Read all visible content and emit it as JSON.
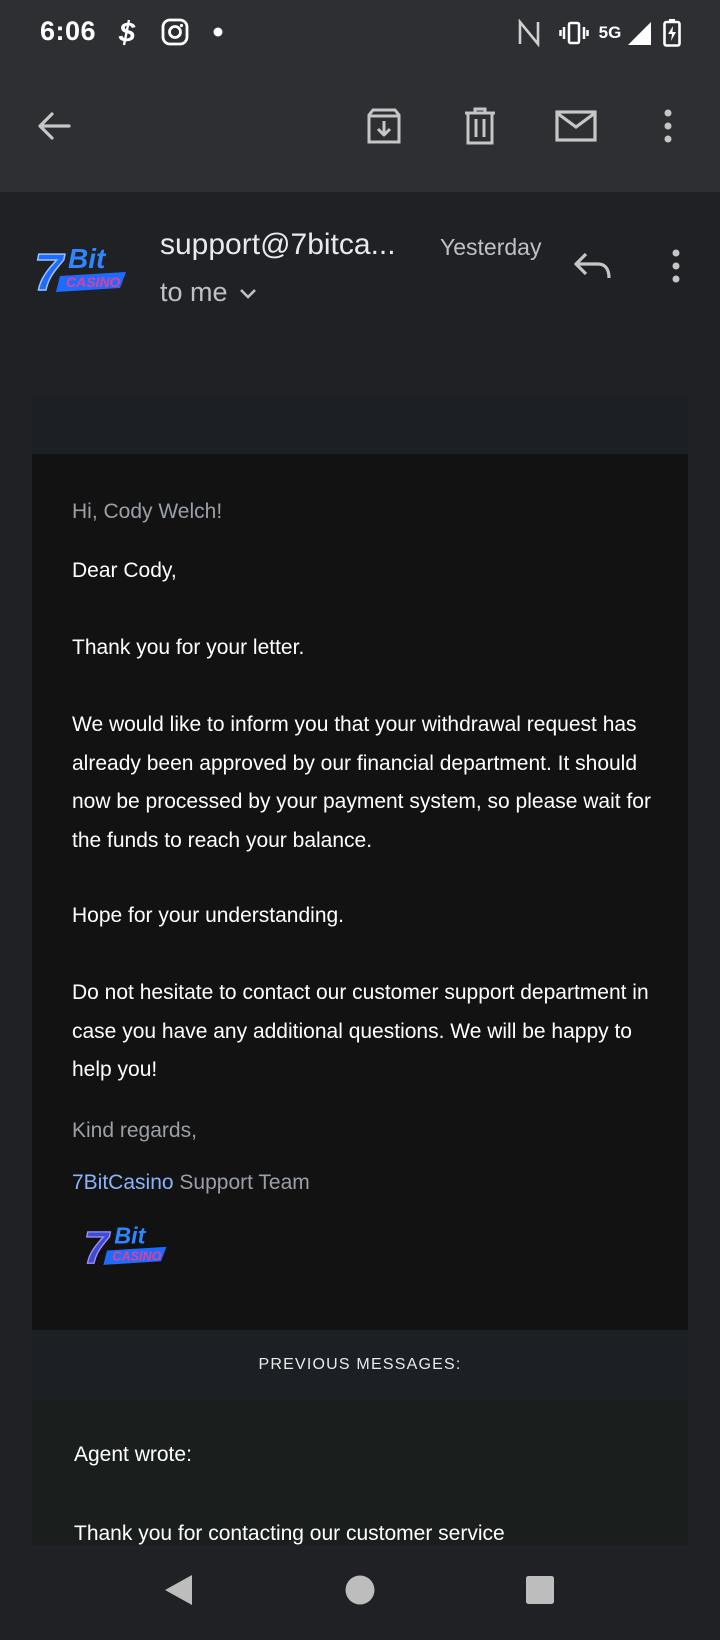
{
  "status_bar": {
    "time": "6:06",
    "network": "5G"
  },
  "app_bar": {
    "icons": [
      "back-arrow-icon",
      "archive-icon",
      "delete-icon",
      "mark-unread-icon",
      "more-vert-icon"
    ]
  },
  "email": {
    "sender": "support@7bitca...",
    "date": "Yesterday",
    "recipient": "to me",
    "greeting": "Hi, Cody Welch!",
    "salutation": "Dear Cody,",
    "paragraphs": [
      "Thank you for your letter.",
      "We would like to inform you that your withdrawal request has already been approved by our financial department. It should now be processed by your payment system, so please wait for the funds to reach your balance.",
      "Hope for your understanding.",
      "Do not hesitate to contact our customer support department in case you have any additional questions. We will be happy to help you!"
    ],
    "closing": "Kind regards,",
    "signature_brand": "7BitCasino",
    "signature_team": " Support Team",
    "logo_text": {
      "top": "Bit",
      "bottom": "CASINO",
      "seven": "7"
    }
  },
  "previous": {
    "header": "PREVIOUS MESSAGES:",
    "agent_wrote": "Agent wrote:",
    "partial_line": "Thank you for contacting our customer service"
  },
  "colors": {
    "background": "#202124",
    "bar": "#2d2f33",
    "card": "#121212",
    "link": "#8ab4f8",
    "logo_blue": "#1e6bff",
    "logo_pink": "#e0409a"
  }
}
